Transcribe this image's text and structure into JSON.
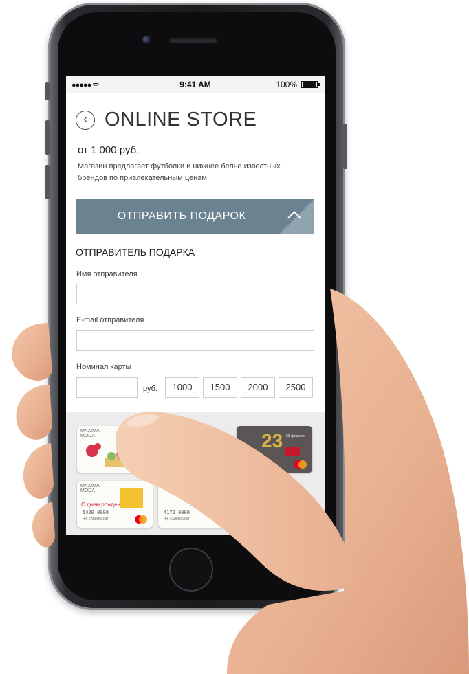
{
  "status_bar": {
    "signal": "●●●●● ᯤ",
    "time": "9:41 AM",
    "battery": "100%"
  },
  "header": {
    "back_icon": "chevron-left-circle-icon",
    "back_glyph": "‹",
    "title": "ONLINE STORE"
  },
  "product": {
    "price": "от 1 000 руб.",
    "description": "Магазин предлагает футболки и нижнее белье известных брендов по привлекательным ценам"
  },
  "send_gift": {
    "label": "ОТПРАВИТЬ ПОДАРОК",
    "icon": "chevron-up-icon"
  },
  "form": {
    "section_title": "ОТПРАВИТЕЛЬ ПОДАРКА",
    "sender_name_label": "Имя отправителя",
    "sender_name_value": "",
    "sender_email_label": "E-mail отправителя",
    "sender_email_value": "",
    "amount_label": "Номинал карты",
    "amount_value": "",
    "currency": "руб.",
    "denominations": [
      "1000",
      "1500",
      "2000",
      "2500"
    ]
  },
  "cards": [
    {
      "brand_line1": "MAXIMA",
      "brand_line2": "MODA",
      "greeting": "",
      "number": "",
      "holder": ""
    },
    {
      "brand_line1": "MAXIMA",
      "brand_line2": "MODA",
      "greeting": "23 февраля",
      "number": "",
      "holder": ""
    },
    {
      "brand_line1": "MAXIMA",
      "brand_line2": "MODA",
      "greeting": "С днем рожденья!",
      "number": "5420 0000",
      "holder": "HH CARDHOLDER"
    },
    {
      "brand_line1": "",
      "brand_line2": "",
      "greeting": "",
      "number": "4172 0000",
      "holder": "HH CARDHOLDER"
    }
  ],
  "colors": {
    "accent_bar": "#6b8390",
    "field_border": "#c8cfd3",
    "phone_body": "#1a1b1d"
  }
}
